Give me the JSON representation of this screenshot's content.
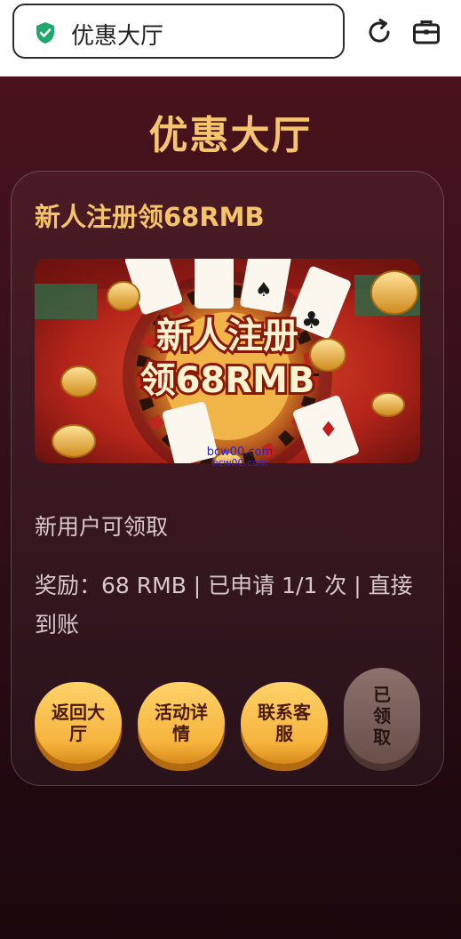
{
  "browser": {
    "address_text": "优惠大厅",
    "icons": [
      "shield-check-icon",
      "reload-icon",
      "briefcase-icon"
    ]
  },
  "page": {
    "title": "优惠大厅"
  },
  "promo": {
    "title": "新人注册领68RMB",
    "banner_line1": "新人注册",
    "banner_line2": "领68RMB",
    "watermark_line1": "bcw00.com",
    "watermark_line2": "bcw00.com",
    "description": "新用户可领取",
    "reward_text": "奖励：68 RMB | 已申请 1/1 次 | 直接到账"
  },
  "buttons": {
    "back_label": "返回大厅",
    "details_label": "活动详情",
    "support_label": "联系客服",
    "claimed_label": "已领取"
  },
  "colors": {
    "accent_gold": "#f4c46f",
    "page_bg": "#3a0f19",
    "button_gold": "#f5b33c",
    "button_disabled": "#7a5e59"
  }
}
